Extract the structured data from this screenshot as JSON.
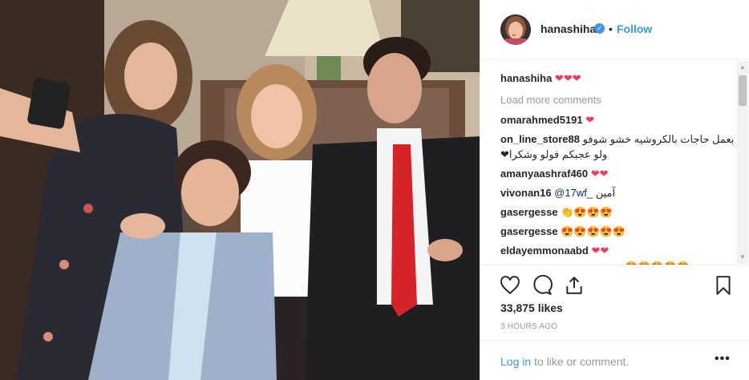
{
  "post": {
    "author": "hanashiha",
    "follow_label": "Follow",
    "dot": "•",
    "likes": "33,875 likes",
    "time_ago": "3 HOURS AGO"
  },
  "comments": {
    "caption_user": "hanashiha",
    "caption_text": "❤❤❤",
    "load_more": "Load more comments",
    "items": [
      {
        "user": "omarahmed5191",
        "text": "❤"
      },
      {
        "user": "on_line_store88",
        "text": "بعمل حاجات بالكروشيه خشو شوفو"
      },
      {
        "user": "",
        "text": "ولو عجبكم فولو وشكرا❤"
      },
      {
        "user": "amanyaashraf460",
        "text": "❤❤"
      },
      {
        "user": "vivonan16",
        "mention": "@17wf_",
        "text": "آمين"
      },
      {
        "user": "gasergesse",
        "text": "👏😍😍😍"
      },
      {
        "user": "gasergesse",
        "text": "😍😍😍😍😍"
      },
      {
        "user": "eldayemmonaabd",
        "text": "❤❤"
      },
      {
        "user": "",
        "text": "😍😍😍😍😍"
      }
    ]
  },
  "footer": {
    "login_link": "Log in",
    "login_rest": " to like or comment.",
    "more": "•••"
  },
  "colors": {
    "accent": "#3897f0",
    "heart": "#f3385b",
    "muted": "#999999"
  },
  "icons": [
    "verified-badge-icon",
    "heart-icon",
    "comment-icon",
    "share-icon",
    "bookmark-icon",
    "more-options-icon",
    "scroll-up-icon",
    "scroll-down-icon"
  ]
}
